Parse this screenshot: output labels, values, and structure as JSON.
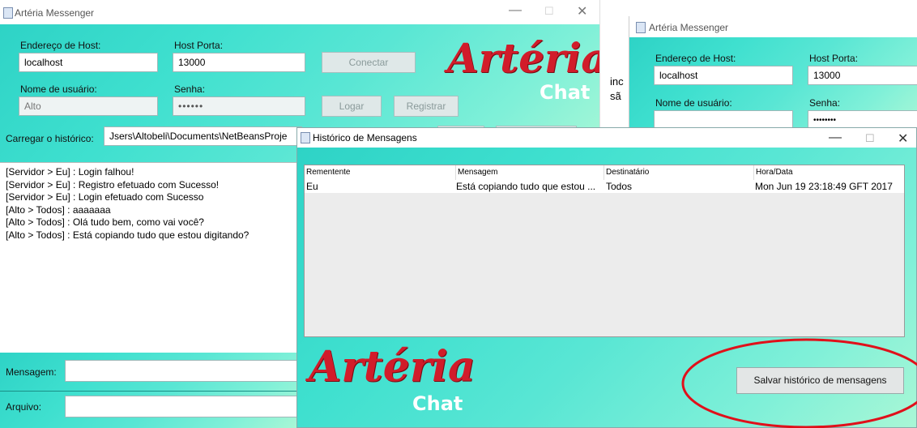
{
  "main_window": {
    "title": "Artéria Messenger",
    "host_label": "Endereço de Host:",
    "host_value": "localhost",
    "port_label": "Host Porta:",
    "port_value": "13000",
    "connect_label": "Conectar",
    "user_label": "Nome de usuário:",
    "user_value": "Alto",
    "password_label": "Senha:",
    "password_value": "••••••",
    "login_label": "Logar",
    "register_label": "Registrar",
    "history_label": "Carregar o histórico:",
    "history_path": "Jsers\\Altobeli\\Documents\\NetBeansProje",
    "log": [
      "[Servidor > Eu] : Login falhou!",
      "[Servidor > Eu] : Registro efetuado com Sucesso!",
      "[Servidor > Eu] : Login efetuado com Sucesso",
      "[Alto > Todos] : aaaaaaa",
      "[Alto > Todos] : Olá tudo bem, como vai você?",
      "[Alto > Todos] : Está copiando tudo que estou digitando?"
    ],
    "message_label": "Mensagem:",
    "file_label": "Arquivo:",
    "logo_main": "Artéria",
    "logo_chat": "Chat"
  },
  "right_window": {
    "title": "Artéria Messenger",
    "host_label": "Endereço de Host:",
    "host_value": "localhost",
    "port_label": "Host Porta:",
    "port_value": "13000",
    "user_label": "Nome de usuário:",
    "password_label": "Senha:",
    "password_value": "••••••••",
    "partial_text_1": "inc",
    "partial_text_2": "sã"
  },
  "history_dialog": {
    "title": "Histórico de Mensagens",
    "columns": [
      "Rementente",
      "Mensagem",
      "Destinatário",
      "Hora/Data"
    ],
    "rows": [
      [
        "Eu",
        "Está copiando tudo que estou ...",
        "Todos",
        "Mon Jun 19 23:18:49 GFT 2017"
      ]
    ],
    "save_label": "Salvar histórico de mensagens",
    "logo_main": "Artéria",
    "logo_chat": "Chat"
  },
  "colors": {
    "teal": "#2ed3c6",
    "logo_red": "#d11c2a",
    "annotation_red": "#e0101a"
  },
  "icons": [
    "java-app-icon",
    "minimize-icon",
    "maximize-icon",
    "close-icon"
  ]
}
